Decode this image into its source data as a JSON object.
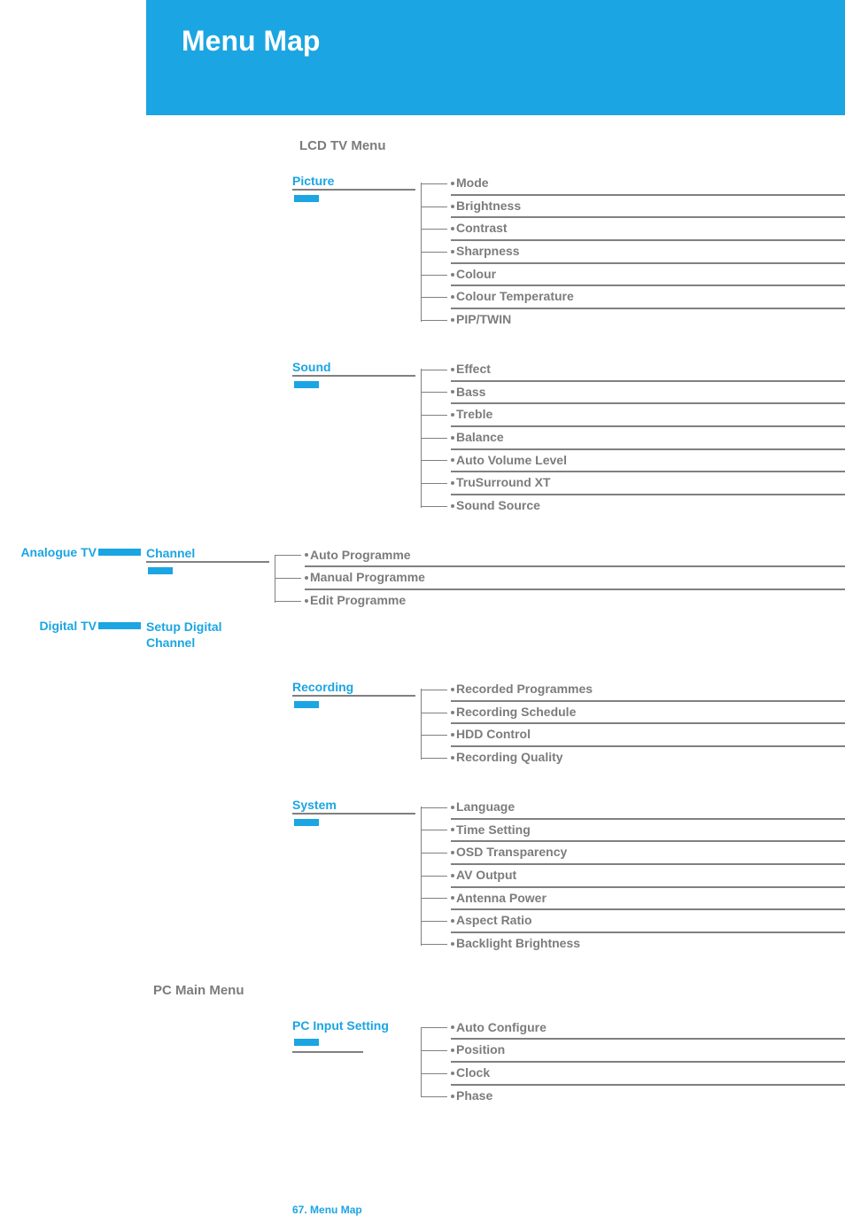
{
  "banner": {
    "title": "Menu Map"
  },
  "sections": {
    "lcd": "LCD TV Menu",
    "pc": "PC Main Menu"
  },
  "tv_labels": {
    "analogue": "Analogue TV",
    "digital": "Digital TV"
  },
  "categories": {
    "picture": {
      "label": "Picture",
      "items": [
        "Mode",
        "Brightness",
        "Contrast",
        "Sharpness",
        "Colour",
        "Colour Temperature",
        "PIP/TWIN"
      ]
    },
    "sound": {
      "label": "Sound",
      "items": [
        "Effect",
        "Bass",
        "Treble",
        "Balance",
        "Auto Volume Level",
        "TruSurround XT",
        "Sound Source"
      ]
    },
    "channel": {
      "label": "Channel",
      "items": [
        "Auto Programme",
        "Manual Programme",
        "Edit Programme"
      ]
    },
    "setup_digital_channel": {
      "label": "Setup Digital Channel",
      "items": []
    },
    "recording": {
      "label": "Recording",
      "items": [
        "Recorded Programmes",
        "Recording Schedule",
        "HDD Control",
        "Recording Quality"
      ]
    },
    "system": {
      "label": "System",
      "items": [
        "Language",
        "Time Setting",
        "OSD Transparency",
        "AV Output",
        "Antenna Power",
        "Aspect Ratio",
        "Backlight Brightness"
      ]
    },
    "pc_input": {
      "label": "PC Input Setting",
      "items": [
        "Auto Configure",
        "Position",
        "Clock",
        "Phase"
      ]
    }
  },
  "footer": {
    "page": "67.",
    "section": "Menu Map"
  }
}
